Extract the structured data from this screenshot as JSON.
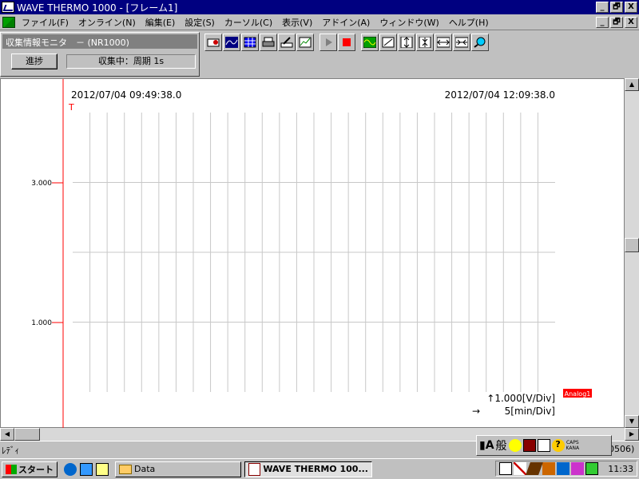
{
  "window": {
    "title": "WAVE THERMO 1000 - [フレーム1]",
    "controls": [
      "_",
      "🗗",
      "X"
    ]
  },
  "menu": {
    "items": [
      "ファイル(F)",
      "オンライン(N)",
      "編集(E)",
      "設定(S)",
      "カーソル(C)",
      "表示(V)",
      "アドイン(A)",
      "ウィンドウ(W)",
      "ヘルプ(H)"
    ],
    "doc_controls": [
      "_",
      "🗗",
      "X"
    ]
  },
  "monitor_panel": {
    "title": "収集情報モニタ　－ (NR1000)",
    "progress_label": "進捗",
    "status_text": "収集中：周期 1s"
  },
  "chart": {
    "start_time": "2012/07/04 09:49:38.0",
    "end_time": "2012/07/04 12:09:38.0",
    "trigger_marker": "T",
    "channel_label": "Analog1",
    "v_div": "↑1.000[V/Div]",
    "h_div_arrow": "→",
    "h_div": "5[min/Div]",
    "colors": {
      "cursor": "#ff0000",
      "grid": "#c8c8c8",
      "channel": "#ff0000"
    }
  },
  "chart_data": {
    "type": "line",
    "title": "",
    "xlabel": "",
    "ylabel": "",
    "x_range": [
      "2012/07/04 09:49:38.0",
      "2012/07/04 12:09:38.0"
    ],
    "y_tick_labels": [
      "3.000",
      "1.000"
    ],
    "grid": true,
    "series": []
  },
  "status_bar": {
    "text": "ﾚﾃﾞｨ",
    "partial_text": "0506)"
  },
  "ime": {
    "mode_label": "般",
    "caps": "CAPS",
    "kana": "KANA"
  },
  "taskbar": {
    "start_label": "スタート",
    "tasks": [
      "Data",
      "WAVE THERMO 100..."
    ],
    "clock": "11:33"
  }
}
